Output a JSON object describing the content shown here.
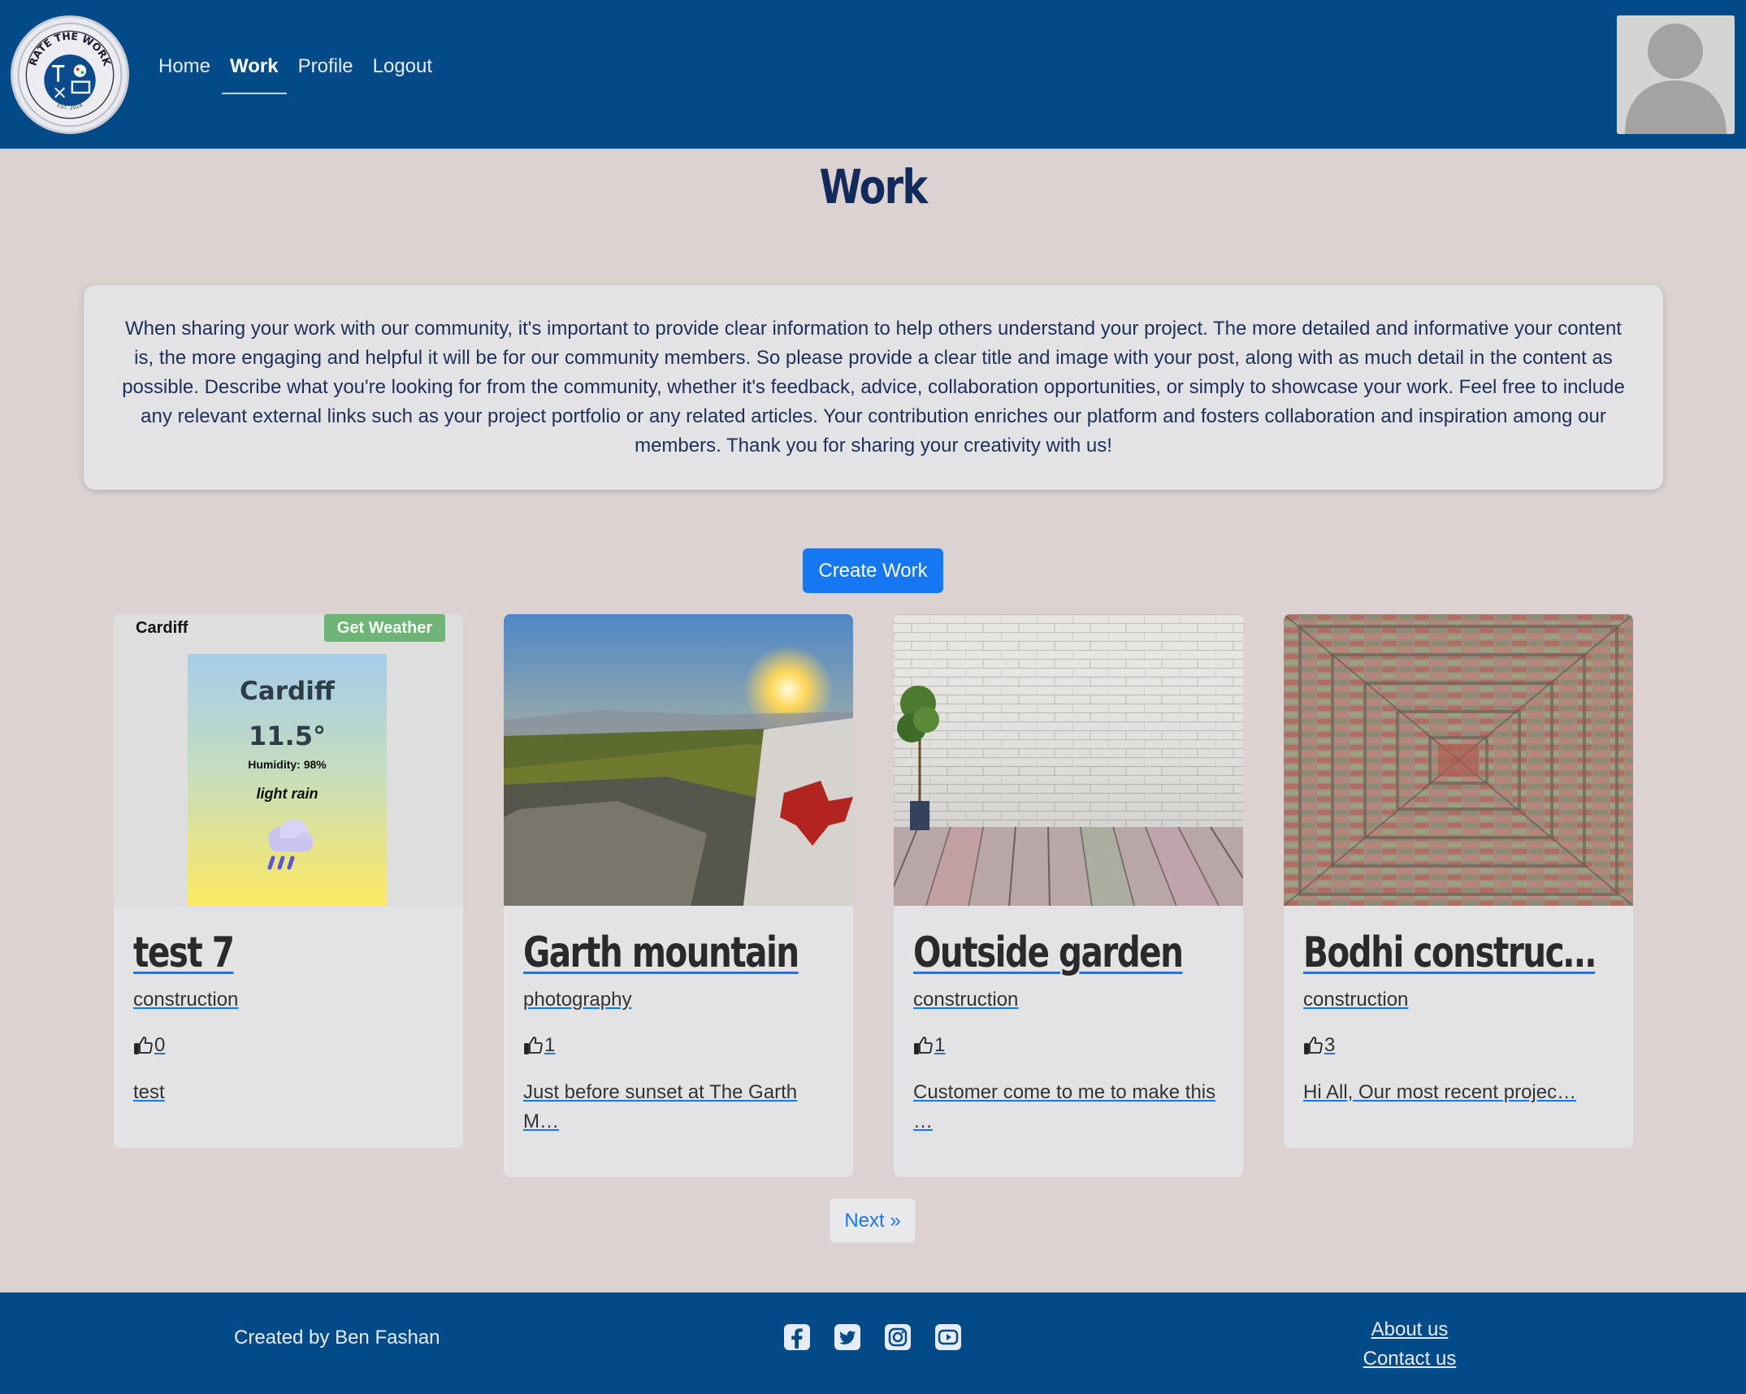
{
  "header": {
    "logo_text": "RATE THE WORK",
    "logo_est": "EST. 2024",
    "nav": [
      {
        "label": "Home",
        "active": false
      },
      {
        "label": "Work",
        "active": true
      },
      {
        "label": "Profile",
        "active": false
      },
      {
        "label": "Logout",
        "active": false
      }
    ],
    "avatar_icon": "user-avatar-icon"
  },
  "page_title": "Work",
  "info_text": "When sharing your work with our community, it's important to provide clear information to help others understand your project. The more detailed and informative your content is, the more engaging and helpful it will be for our community members. So please provide a clear title and image with your post, along with as much detail in the content as possible. Describe what you're looking for from the community, whether it's feedback, advice, collaboration opportunities, or simply to showcase your work. Feel free to include any relevant external links such as your project portfolio or any related articles. Your contribution enriches our platform and fosters collaboration and inspiration among our members. Thank you for sharing your creativity with us!",
  "create_button": "Create Work",
  "weather": {
    "city_label": "Cardiff",
    "button": "Get Weather",
    "city": "Cardiff",
    "temperature": "11.5°",
    "humidity": "Humidity: 98%",
    "description": "light rain",
    "icon": "rain-cloud-icon"
  },
  "cards": [
    {
      "title": "test 7",
      "category": "construction",
      "likes": "0",
      "excerpt": "test",
      "image": "weather-widget"
    },
    {
      "title": "Garth mountain",
      "category": "photography",
      "likes": "1",
      "excerpt": "Just before sunset at The Garth M…",
      "image": "mountain-sunset-photo"
    },
    {
      "title": "Outside garden",
      "category": "construction",
      "likes": "1",
      "excerpt": "Customer come to me to make this …",
      "image": "brick-wall-deck-photo"
    },
    {
      "title": "Bodhi construc…",
      "category": "construction",
      "likes": "3",
      "excerpt": "Hi All, Our most recent projec…",
      "image": "brick-paving-photo"
    }
  ],
  "pagination": {
    "next": "Next »"
  },
  "footer": {
    "credit": "Created by Ben Fashan",
    "socials": [
      "facebook-icon",
      "twitter-icon",
      "instagram-icon",
      "youtube-icon"
    ],
    "links": [
      "About us",
      "Contact us"
    ]
  },
  "colors": {
    "header_bg": "#034a88",
    "page_bg": "#dcd2d2",
    "accent": "#1677f2",
    "card_bg": "#e3e2e4",
    "weather_button": "#6fb476"
  }
}
